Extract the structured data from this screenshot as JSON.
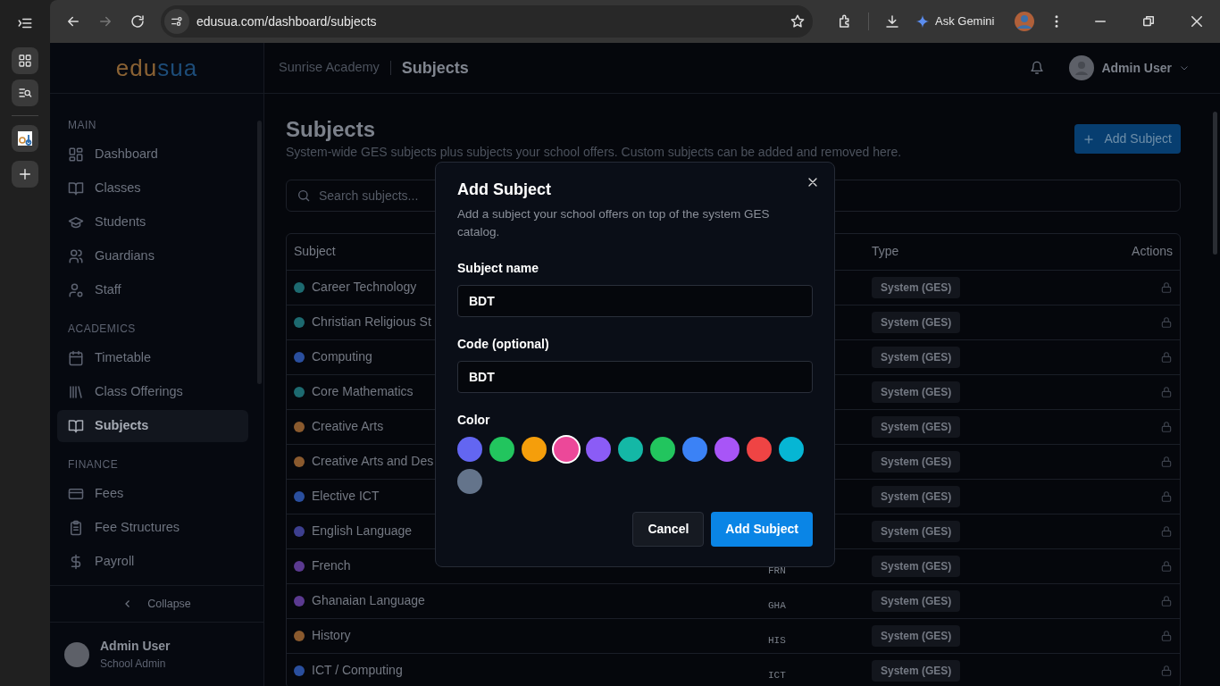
{
  "browser": {
    "url": "edusua.com/dashboard/subjects",
    "assistant": "Ask Gemini"
  },
  "brand": {
    "first": "edu",
    "second": "sua"
  },
  "header": {
    "school": "Sunrise Academy",
    "page": "Subjects",
    "user": "Admin User"
  },
  "sidebar": {
    "sections": [
      {
        "title": "MAIN",
        "items": [
          {
            "label": "Dashboard",
            "kind": "grid",
            "selected": false
          },
          {
            "label": "Classes",
            "kind": "book",
            "selected": false
          },
          {
            "label": "Students",
            "kind": "cap",
            "selected": false
          },
          {
            "label": "Guardians",
            "kind": "users",
            "selected": false
          },
          {
            "label": "Staff",
            "kind": "usergear",
            "selected": false
          }
        ]
      },
      {
        "title": "ACADEMICS",
        "items": [
          {
            "label": "Timetable",
            "kind": "calendar",
            "selected": false
          },
          {
            "label": "Class Offerings",
            "kind": "library",
            "selected": false
          },
          {
            "label": "Subjects",
            "kind": "book",
            "selected": true
          }
        ]
      },
      {
        "title": "FINANCE",
        "items": [
          {
            "label": "Fees",
            "kind": "card",
            "selected": false
          },
          {
            "label": "Fee Structures",
            "kind": "clipboard",
            "selected": false
          },
          {
            "label": "Payroll",
            "kind": "dollar",
            "selected": false
          }
        ]
      }
    ],
    "collapse": "Collapse",
    "profile": {
      "name": "Admin User",
      "role": "School Admin"
    }
  },
  "page": {
    "title": "Subjects",
    "subtitle": "System-wide GES subjects plus subjects your school offers. Custom subjects can be added and removed here.",
    "add_button": "Add Subject",
    "search": {
      "placeholder": "Search subjects..."
    }
  },
  "table": {
    "columns": [
      "Subject",
      "Type",
      "Actions"
    ],
    "rows": [
      {
        "name": "Career Technology",
        "color": "#1d6a70",
        "type": "System (GES)"
      },
      {
        "name": "Christian Religious St",
        "color": "#1d6a70",
        "type": "System (GES)"
      },
      {
        "name": "Computing",
        "color": "#2a4f9e",
        "type": "System (GES)"
      },
      {
        "name": "Core Mathematics",
        "color": "#1d6a70",
        "type": "System (GES)"
      },
      {
        "name": "Creative Arts",
        "color": "#8a5a2e",
        "type": "System (GES)"
      },
      {
        "name": "Creative Arts and Des",
        "color": "#8a5a2e",
        "type": "System (GES)"
      },
      {
        "name": "Elective ICT",
        "color": "#2a4f9e",
        "type": "System (GES)"
      },
      {
        "name": "English Language",
        "color": "#3d3f8f",
        "type": "System (GES)"
      },
      {
        "name": "French",
        "code": "FRN",
        "color": "#5b3a90",
        "type": "System (GES)"
      },
      {
        "name": "Ghanaian Language",
        "code": "GHA",
        "color": "#5b3a90",
        "type": "System (GES)"
      },
      {
        "name": "History",
        "code": "HIS",
        "color": "#8a5a2e",
        "type": "System (GES)"
      },
      {
        "name": "ICT / Computing",
        "code": "ICT",
        "color": "#2a4f9e",
        "type": "System (GES)"
      }
    ]
  },
  "modal": {
    "title": "Add Subject",
    "description": "Add a subject your school offers on top of the system GES catalog.",
    "fields": [
      {
        "label": "Subject name",
        "value": "BDT"
      },
      {
        "label": "Code (optional)",
        "value": "BDT"
      }
    ],
    "color_label": "Color",
    "swatches": [
      {
        "color": "#6366f1",
        "selected": false
      },
      {
        "color": "#22c55e",
        "selected": false
      },
      {
        "color": "#f59e0b",
        "selected": false
      },
      {
        "color": "#ec4899",
        "selected": true
      },
      {
        "color": "#8b5cf6",
        "selected": false
      },
      {
        "color": "#14b8a6",
        "selected": false
      },
      {
        "color": "#22c55e",
        "selected": false
      },
      {
        "color": "#3b82f6",
        "selected": false
      },
      {
        "color": "#a855f7",
        "selected": false
      },
      {
        "color": "#ef4444",
        "selected": false
      },
      {
        "color": "#06b6d4",
        "selected": false
      },
      {
        "color": "#64748b",
        "selected": false
      }
    ],
    "cancel": "Cancel",
    "submit": "Add Subject"
  }
}
